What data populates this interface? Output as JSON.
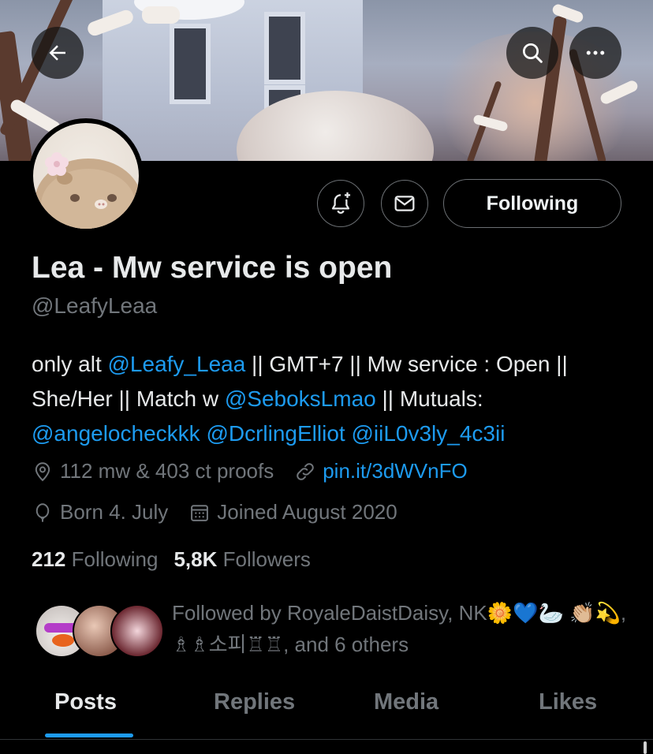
{
  "header": {
    "back_icon": "arrow-left-icon",
    "search_icon": "search-icon",
    "more_icon": "more-horizontal-icon"
  },
  "actions": {
    "notify_icon": "bell-plus-icon",
    "message_icon": "envelope-icon",
    "follow_label": "Following"
  },
  "profile": {
    "name": "Lea - Mw service is open",
    "handle": "@LeafyLeaa"
  },
  "bio": {
    "p1": "only alt ",
    "m1": "@Leafy_Leaa",
    "p2": " || GMT+7 || Mw service : Open || She/Her || Match w ",
    "m2": "@SeboksLmao",
    "p3": " || Mutuals: ",
    "m3": "@angelocheckkk",
    "p4": " ",
    "m4": "@DcrlingElliot",
    "p5": " ",
    "m5": "@iiL0v3ly_4c3ii"
  },
  "meta": {
    "location": "112 mw & 403 ct proofs",
    "link": "pin.it/3dWVnFO",
    "birthday": "Born 4. July",
    "joined": "Joined August 2020"
  },
  "stats": {
    "following_count": "212",
    "following_label": "Following",
    "followers_count": "5,8K",
    "followers_label": "Followers"
  },
  "followed_by": {
    "text": "Followed by RoyaleDaistDaisy, NK🌼💙🦢 👏🏼💫, ♗♗소피♖♖, and 6 others"
  },
  "tabs": [
    {
      "label": "Posts"
    },
    {
      "label": "Replies"
    },
    {
      "label": "Media"
    },
    {
      "label": "Likes"
    }
  ],
  "colors": {
    "accent": "#1d9bf0",
    "background": "#000000",
    "secondary_text": "#71767b"
  }
}
